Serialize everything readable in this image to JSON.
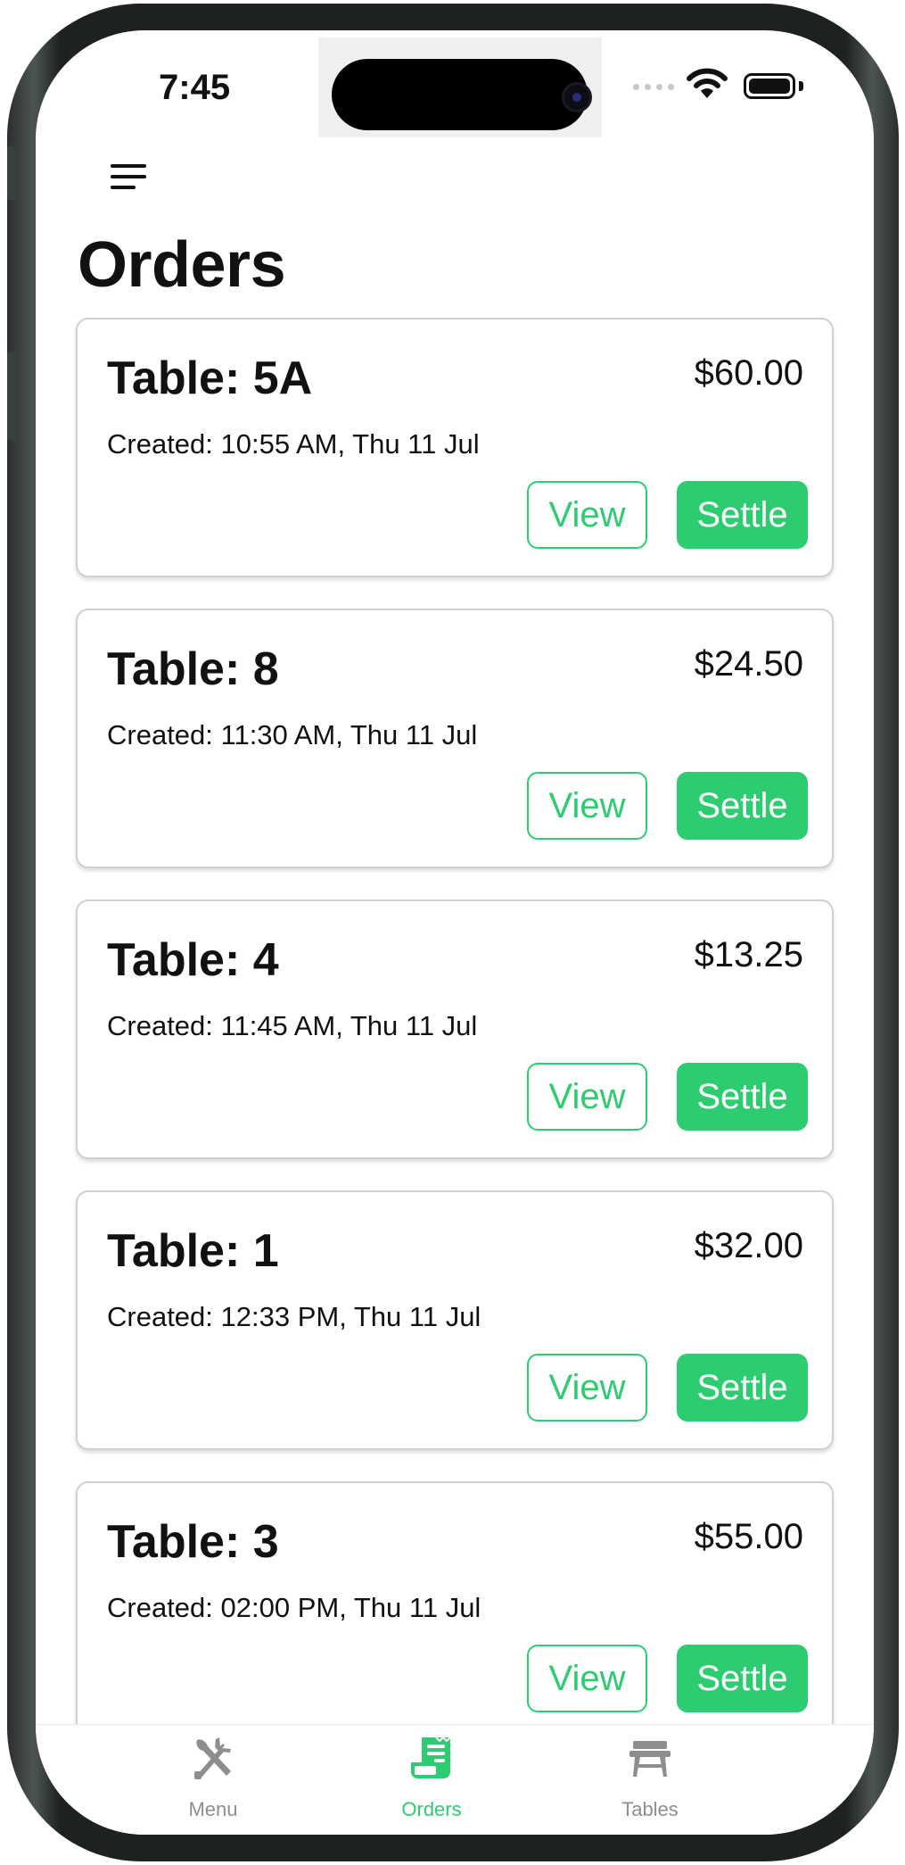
{
  "status_bar": {
    "time": "7:45"
  },
  "header": {
    "title": "Orders"
  },
  "orders": [
    {
      "table": "Table: 5A",
      "total": "$60.00",
      "created": "Created: 10:55 AM, Thu 11 Jul",
      "view_label": "View",
      "settle_label": "Settle"
    },
    {
      "table": "Table: 8",
      "total": "$24.50",
      "created": "Created: 11:30 AM, Thu 11 Jul",
      "view_label": "View",
      "settle_label": "Settle"
    },
    {
      "table": "Table: 4",
      "total": "$13.25",
      "created": "Created: 11:45 AM, Thu 11 Jul",
      "view_label": "View",
      "settle_label": "Settle"
    },
    {
      "table": "Table: 1",
      "total": "$32.00",
      "created": "Created: 12:33 PM, Thu 11 Jul",
      "view_label": "View",
      "settle_label": "Settle"
    },
    {
      "table": "Table: 3",
      "total": "$55.00",
      "created": "Created: 02:00 PM, Thu 11 Jul",
      "view_label": "View",
      "settle_label": "Settle"
    }
  ],
  "tab_bar": {
    "items": [
      {
        "label": "Menu",
        "icon": "utensils-icon",
        "active": false
      },
      {
        "label": "Orders",
        "icon": "receipt-icon",
        "active": true
      },
      {
        "label": "Tables",
        "icon": "table-icon",
        "active": false
      }
    ]
  },
  "colors": {
    "accent": "#2ecc71",
    "inactive_tab": "#8e8e8e",
    "text": "#111111",
    "card_border": "#d0d0d0"
  }
}
